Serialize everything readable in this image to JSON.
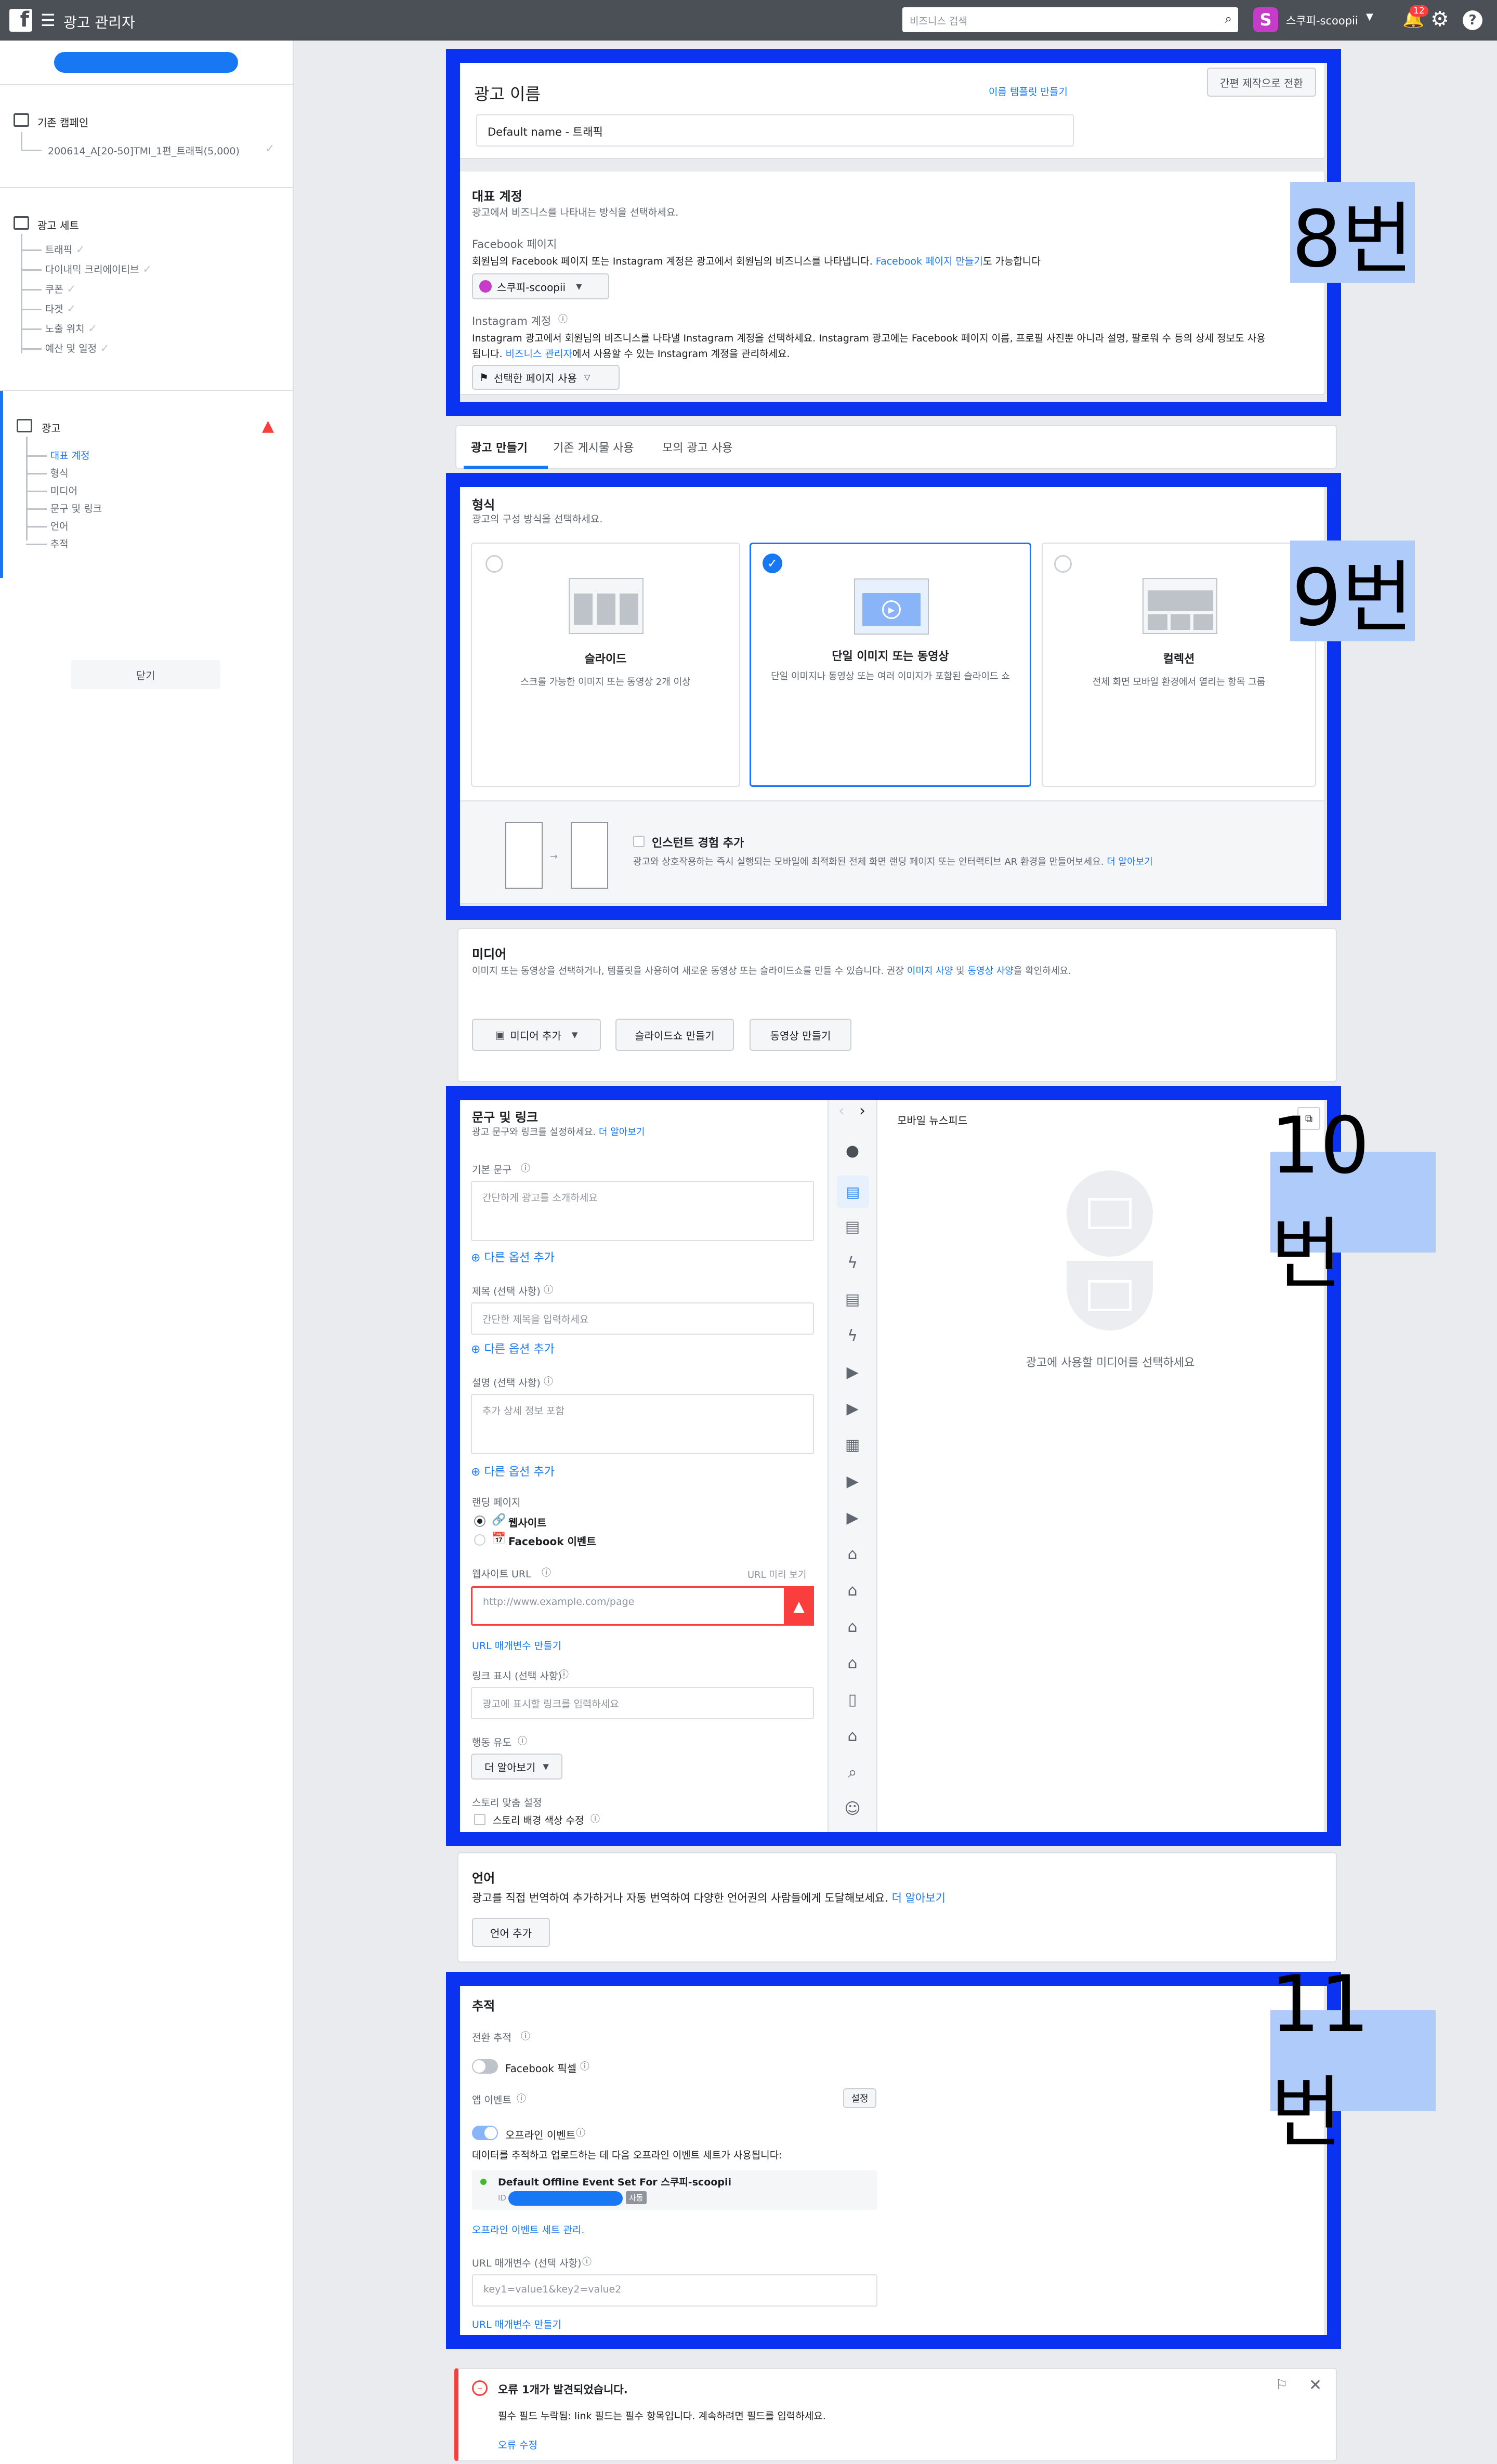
{
  "topbar": {
    "logo": "f",
    "title": "광고 관리자",
    "search_placeholder": "비즈니스 검색",
    "account": "스쿠피-scoopii",
    "avatar_letter": "S",
    "notif_count": "12"
  },
  "sidebar": {
    "campaign_header": "기존 캠페인",
    "campaign_name": "200614_A[20-50]TMI_1편_트래픽(5,000)",
    "adset_header": "광고 세트",
    "adset_items": [
      "트래픽",
      "다이내믹 크리에이티브",
      "쿠폰",
      "타겟",
      "노출 위치",
      "예산 및 일정"
    ],
    "ad_header": "광고",
    "ad_items": [
      "대표 계정",
      "형식",
      "미디어",
      "문구 및 링크",
      "언어",
      "추적"
    ],
    "close_button": "닫기"
  },
  "ad_name": {
    "title": "광고 이름",
    "template_link": "이름 템플릿 만들기",
    "quick_button": "간편 제작으로 전환",
    "value": "Default name - 트래픽"
  },
  "identity": {
    "title": "대표 계정",
    "subtitle": "광고에서 비즈니스를 나타내는 방식을 선택하세요.",
    "fb_label": "Facebook 페이지",
    "fb_desc": "회원님의 Facebook 페이지 또는 Instagram 계정은 광고에서 회원님의 비즈니스를 나타냅니다.",
    "fb_desc_link": "Facebook 페이지 만들기",
    "fb_desc_suffix": "도 가능합니다",
    "page_name": "스쿠피-scoopii",
    "ig_label": "Instagram 계정",
    "ig_desc": "Instagram 광고에서 회원님의 비즈니스를 나타낼 Instagram 계정을 선택하세요. Instagram 광고에는 Facebook 페이지 이름, 프로필 사진뿐 아니라 설명, 팔로워 수 등의 상세 정보도 사용",
    "ig_desc2_prefix": "됩니다.",
    "ig_desc2_link": "비즈니스 관리자",
    "ig_desc2_suffix": "에서 사용할 수 있는 Instagram 계정을 관리하세요.",
    "ig_button": "선택한 페이지 사용"
  },
  "tabs": [
    "광고 만들기",
    "기존 게시물 사용",
    "모의 광고 사용"
  ],
  "format": {
    "title": "형식",
    "subtitle": "광고의 구성 방식을 선택하세요.",
    "options": [
      {
        "title": "슬라이드",
        "desc": "스크롤 가능한 이미지 또는 동영상 2개 이상"
      },
      {
        "title": "단일 이미지 또는 동영상",
        "desc": "단일 이미지나 동영상 또는 여러 이미지가 포함된 슬라이드 쇼"
      },
      {
        "title": "컬렉션",
        "desc": "전체 화면 모바일 환경에서 열리는 항목 그룹"
      }
    ],
    "instant_title": "인스턴트 경험 추가",
    "instant_desc": "광고와 상호작용하는 즉시 실행되는 모바일에 최적화된 전체 화면 랜딩 페이지 또는 인터랙티브 AR 환경을 만들어보세요.",
    "instant_link": "더 알아보기"
  },
  "media": {
    "title": "미디어",
    "desc": "이미지 또는 동영상을 선택하거나, 템플릿을 사용하여 새로운 동영상 또는 슬라이드쇼를 만들 수 있습니다. 권장",
    "desc_link1": "이미지 사양",
    "desc_mid": "및",
    "desc_link2": "동영상 사양",
    "desc_suffix": "을 확인하세요.",
    "add_button": "미디어 추가",
    "slideshow_button": "슬라이드쇼 만들기",
    "video_button": "동영상 만들기"
  },
  "copy": {
    "title": "문구 및 링크",
    "subtitle": "광고 문구와 링크를 설정하세요.",
    "subtitle_link": "더 알아보기",
    "primary_label": "기본 문구",
    "primary_placeholder": "간단하게 광고를 소개하세요",
    "add_option": "다른 옵션 추가",
    "headline_label": "제목 (선택 사항)",
    "headline_placeholder": "간단한 제목을 입력하세요",
    "desc_label": "설명 (선택 사항)",
    "desc_placeholder": "추가 상세 정보 포함",
    "landing_label": "랜딩 페이지",
    "landing_website": "웹사이트",
    "landing_event": "Facebook 이벤트",
    "url_label": "웹사이트 URL",
    "url_preview": "URL 미리 보기",
    "url_placeholder": "http://www.example.com/page",
    "url_params": "URL 매개변수 만들기",
    "display_label": "링크 표시 (선택 사항)",
    "display_placeholder": "광고에 표시할 링크를 입력하세요",
    "cta_label": "행동 유도",
    "cta_value": "더 알아보기",
    "story_label": "스토리 맞춤 설정",
    "story_check": "스토리 배경 색상 수정"
  },
  "preview": {
    "title": "모바일 뉴스피드",
    "empty": "광고에 사용할 미디어를 선택하세요"
  },
  "language": {
    "title": "언어",
    "desc": "광고를 직접 번역하여 추가하거나 자동 번역하여 다양한 언어권의 사람들에게 도달해보세요.",
    "link": "더 알아보기",
    "button": "언어 추가"
  },
  "tracking": {
    "title": "추적",
    "conv_label": "전환 추적",
    "pixel": "Facebook 픽셀",
    "app_label": "앱 이벤트",
    "settings": "설정",
    "offline": "오프라인 이벤트",
    "offline_desc": "데이터를 추적하고 업로드하는 데 다음 오프라인 이벤트 세트가 사용됩니다:",
    "event_set": "Default Offline Event Set For 스쿠피-scoopii",
    "event_id_prefix": "ID",
    "auto_badge": "자동",
    "manage_link": "오프라인 이벤트 세트 관리.",
    "url_params_label": "URL 매개변수 (선택 사항)",
    "url_params_placeholder": "key1=value1&key2=value2",
    "url_params_link": "URL 매개변수 만들기"
  },
  "error": {
    "title": "오류 1개가 발견되었습니다.",
    "desc": "필수 필드 누락됨: link 필드는 필수 항목입니다. 계속하려면 필드를 입력하세요.",
    "fix": "오류 수정"
  },
  "annotations": [
    "8번",
    "9번",
    "10번",
    "11번"
  ]
}
